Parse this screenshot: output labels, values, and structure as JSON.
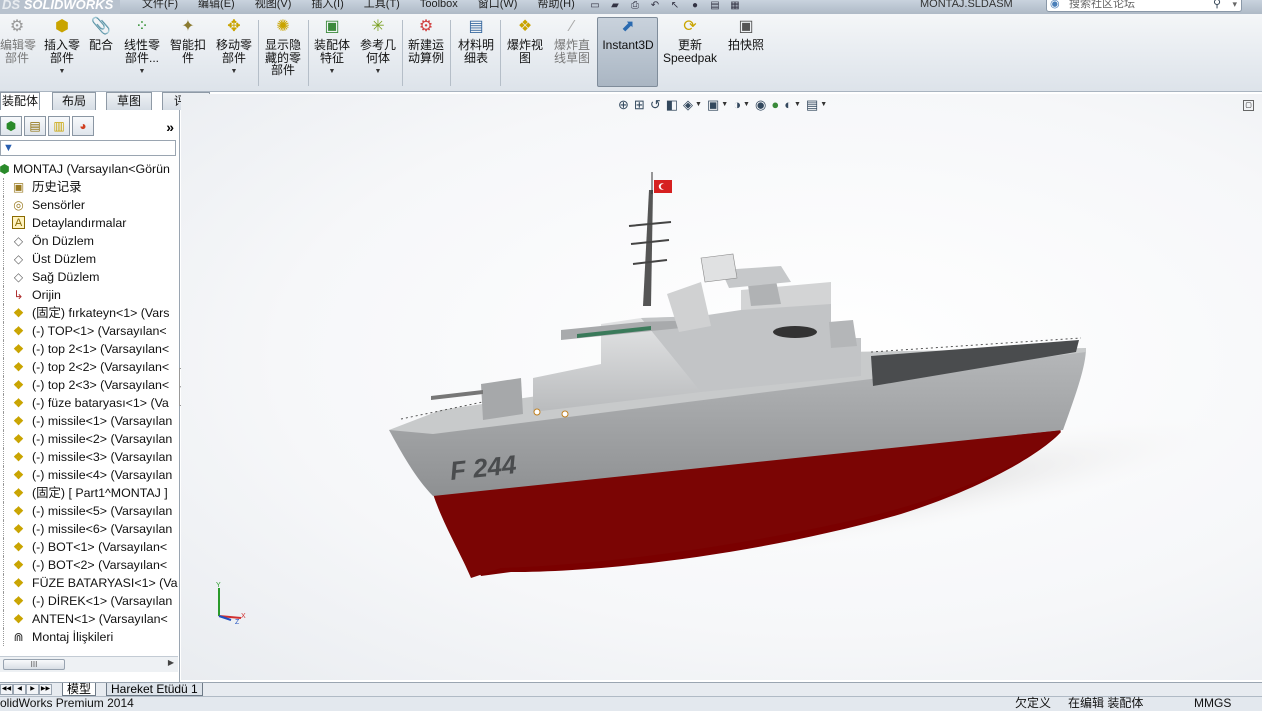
{
  "app": {
    "logo_text": "SOLIDWORKS",
    "logo_prefix": "DS",
    "document_title": "MONTAJ.SLDASM"
  },
  "menubar": {
    "items": [
      "文件(F)",
      "编辑(E)",
      "视图(V)",
      "插入(I)",
      "工具(T)",
      "Toolbox",
      "窗口(W)",
      "帮助(H)"
    ],
    "search_placeholder": "搜索社区论坛"
  },
  "ribbon": {
    "buttons": [
      {
        "label": "编辑零\n部件",
        "icon": "edit-component-icon",
        "enabled": false
      },
      {
        "label": "插入零\n部件",
        "icon": "insert-component-icon",
        "enabled": true,
        "has_dropdown": true
      },
      {
        "label": "配合",
        "icon": "mate-icon",
        "enabled": true
      },
      {
        "label": "线性零\n部件...",
        "icon": "linear-pattern-icon",
        "enabled": true,
        "has_dropdown": true
      },
      {
        "label": "智能扣\n件",
        "icon": "smart-fasteners-icon",
        "enabled": true
      },
      {
        "label": "移动零\n部件",
        "icon": "move-component-icon",
        "enabled": true,
        "has_dropdown": true
      },
      {
        "label": "显示隐\n藏的零\n部件",
        "icon": "show-hidden-icon",
        "enabled": true
      },
      {
        "label": "装配体\n特征",
        "icon": "assembly-features-icon",
        "enabled": true,
        "has_dropdown": true
      },
      {
        "label": "参考几\n何体",
        "icon": "reference-geometry-icon",
        "enabled": true,
        "has_dropdown": true
      },
      {
        "label": "新建运\n动算例",
        "icon": "new-motion-study-icon",
        "enabled": true
      },
      {
        "label": "材料明\n细表",
        "icon": "bill-of-materials-icon",
        "enabled": true
      },
      {
        "label": "爆炸视\n图",
        "icon": "exploded-view-icon",
        "enabled": true
      },
      {
        "label": "爆炸直\n线草图",
        "icon": "explode-line-sketch-icon",
        "enabled": false
      },
      {
        "label": "Instant3D",
        "icon": "instant3d-icon",
        "enabled": true,
        "active": true
      },
      {
        "label": "更新\nSpeedpak",
        "icon": "update-speedpak-icon",
        "enabled": true
      },
      {
        "label": "拍快照",
        "icon": "snapshot-icon",
        "enabled": true
      }
    ]
  },
  "command_tabs": [
    "装配体",
    "布局",
    "草图",
    "评估"
  ],
  "feature_manager": {
    "filter_symbol": "▼",
    "root": "MONTAJ  (Varsayılan<Görün",
    "items": [
      {
        "label": "历史记录",
        "icon": "history-icon"
      },
      {
        "label": "Sensörler",
        "icon": "sensors-icon"
      },
      {
        "label": "Detaylandırmalar",
        "icon": "annotations-icon"
      },
      {
        "label": "Ön Düzlem",
        "icon": "plane-icon"
      },
      {
        "label": "Üst Düzlem",
        "icon": "plane-icon"
      },
      {
        "label": "Sağ Düzlem",
        "icon": "plane-icon"
      },
      {
        "label": "Orijin",
        "icon": "origin-icon"
      },
      {
        "label": "(固定) fırkateyn<1> (Vars",
        "icon": "part-icon"
      },
      {
        "label": "(-) TOP<1> (Varsayılan<",
        "icon": "part-icon"
      },
      {
        "label": "(-) top 2<1> (Varsayılan<",
        "icon": "part-icon"
      },
      {
        "label": "(-) top 2<2> (Varsayılan<",
        "icon": "part-icon"
      },
      {
        "label": "(-) top 2<3> (Varsayılan<",
        "icon": "part-icon"
      },
      {
        "label": "(-) füze bataryası<1> (Va",
        "icon": "part-icon"
      },
      {
        "label": "(-) missile<1> (Varsayılan",
        "icon": "part-icon"
      },
      {
        "label": "(-) missile<2> (Varsayılan",
        "icon": "part-icon"
      },
      {
        "label": "(-) missile<3> (Varsayılan",
        "icon": "part-icon"
      },
      {
        "label": "(-) missile<4> (Varsayılan",
        "icon": "part-icon"
      },
      {
        "label": "(固定) [ Part1^MONTAJ ]",
        "icon": "part-icon"
      },
      {
        "label": "(-) missile<5> (Varsayılan",
        "icon": "part-icon"
      },
      {
        "label": "(-) missile<6> (Varsayılan",
        "icon": "part-icon"
      },
      {
        "label": "(-) BOT<1> (Varsayılan<",
        "icon": "part-icon"
      },
      {
        "label": "(-) BOT<2> (Varsayılan<",
        "icon": "part-icon"
      },
      {
        "label": "FÜZE BATARYASI<1> (Va",
        "icon": "part-icon"
      },
      {
        "label": "(-) DİREK<1> (Varsayılan",
        "icon": "part-icon"
      },
      {
        "label": "ANTEN<1> (Varsayılan<",
        "icon": "part-icon"
      },
      {
        "label": "Montaj İlişkileri",
        "icon": "mates-folder-icon"
      }
    ],
    "scroll_thumb": "III"
  },
  "viewport": {
    "hull_marking": "F 244",
    "axis_labels": {
      "x": "X",
      "y": "Y",
      "z": "Z"
    },
    "colors": {
      "hull_grey": "#9a9c9e",
      "hull_red": "#7a0000",
      "flag_red": "#d62020"
    }
  },
  "bottom_tabs": [
    "模型",
    "Hareket Etüdü 1"
  ],
  "statusbar": {
    "app_name": "olidWorks Premium 2014",
    "under_defined": "欠定义",
    "editing": "在编辑 装配体",
    "units": "MMGS"
  }
}
